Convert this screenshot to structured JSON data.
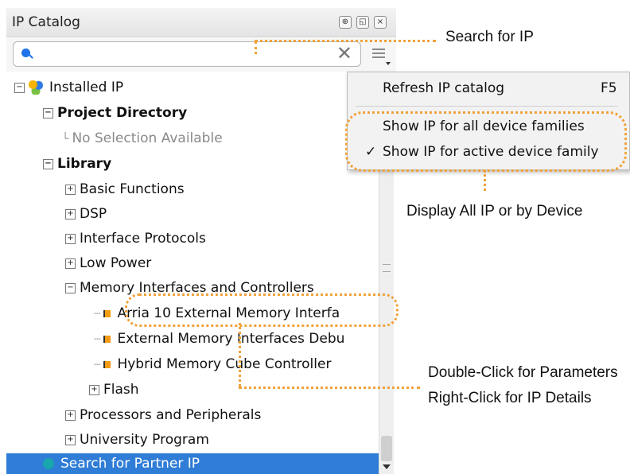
{
  "window": {
    "title": "IP Catalog"
  },
  "search": {
    "placeholder": ""
  },
  "tree": {
    "installed_ip": "Installed IP",
    "project_directory": "Project Directory",
    "no_selection": "No Selection Available",
    "library": "Library",
    "categories": [
      "Basic Functions",
      "DSP",
      "Interface Protocols",
      "Low Power",
      "Memory Interfaces and Controllers"
    ],
    "memory_items": [
      "Arria 10 External Memory Interfa",
      "External Memory Interfaces Debu",
      "Hybrid Memory Cube Controller"
    ],
    "flash": "Flash",
    "more_categories": [
      "Processors and Peripherals",
      "University Program"
    ],
    "partner_ip": "Search for Partner IP"
  },
  "menu": {
    "refresh_label": "Refresh IP catalog",
    "refresh_shortcut": "F5",
    "show_all": "Show IP for all device families",
    "show_active": "Show IP for active device family",
    "show_active_checked": true
  },
  "callouts": {
    "search": "Search for IP",
    "display": "Display All IP or by Device",
    "double_click": "Double-Click for Parameters",
    "right_click": "Right-Click for IP Details"
  },
  "colors": {
    "selection": "#2f7dd6",
    "highlight": "#f0a23a",
    "search_accent": "#1e73e8"
  }
}
